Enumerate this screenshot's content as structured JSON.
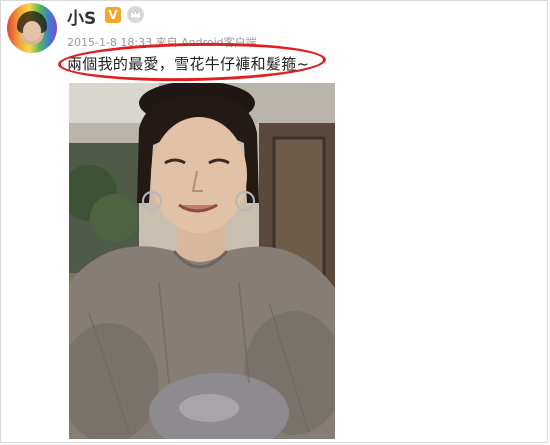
{
  "user": {
    "name": "小S",
    "badge": "V"
  },
  "post": {
    "meta": "2015-1-8 18:33 来自 Android客户端",
    "text": "兩個我的最愛，雪花牛仔褲和髮箍~"
  },
  "icons": {
    "avatar": "avatar-image",
    "badge": "verified-badge-icon",
    "crown": "crown-icon"
  },
  "colors": {
    "highlight_circle": "#e02020",
    "badge": "#f5a623"
  }
}
